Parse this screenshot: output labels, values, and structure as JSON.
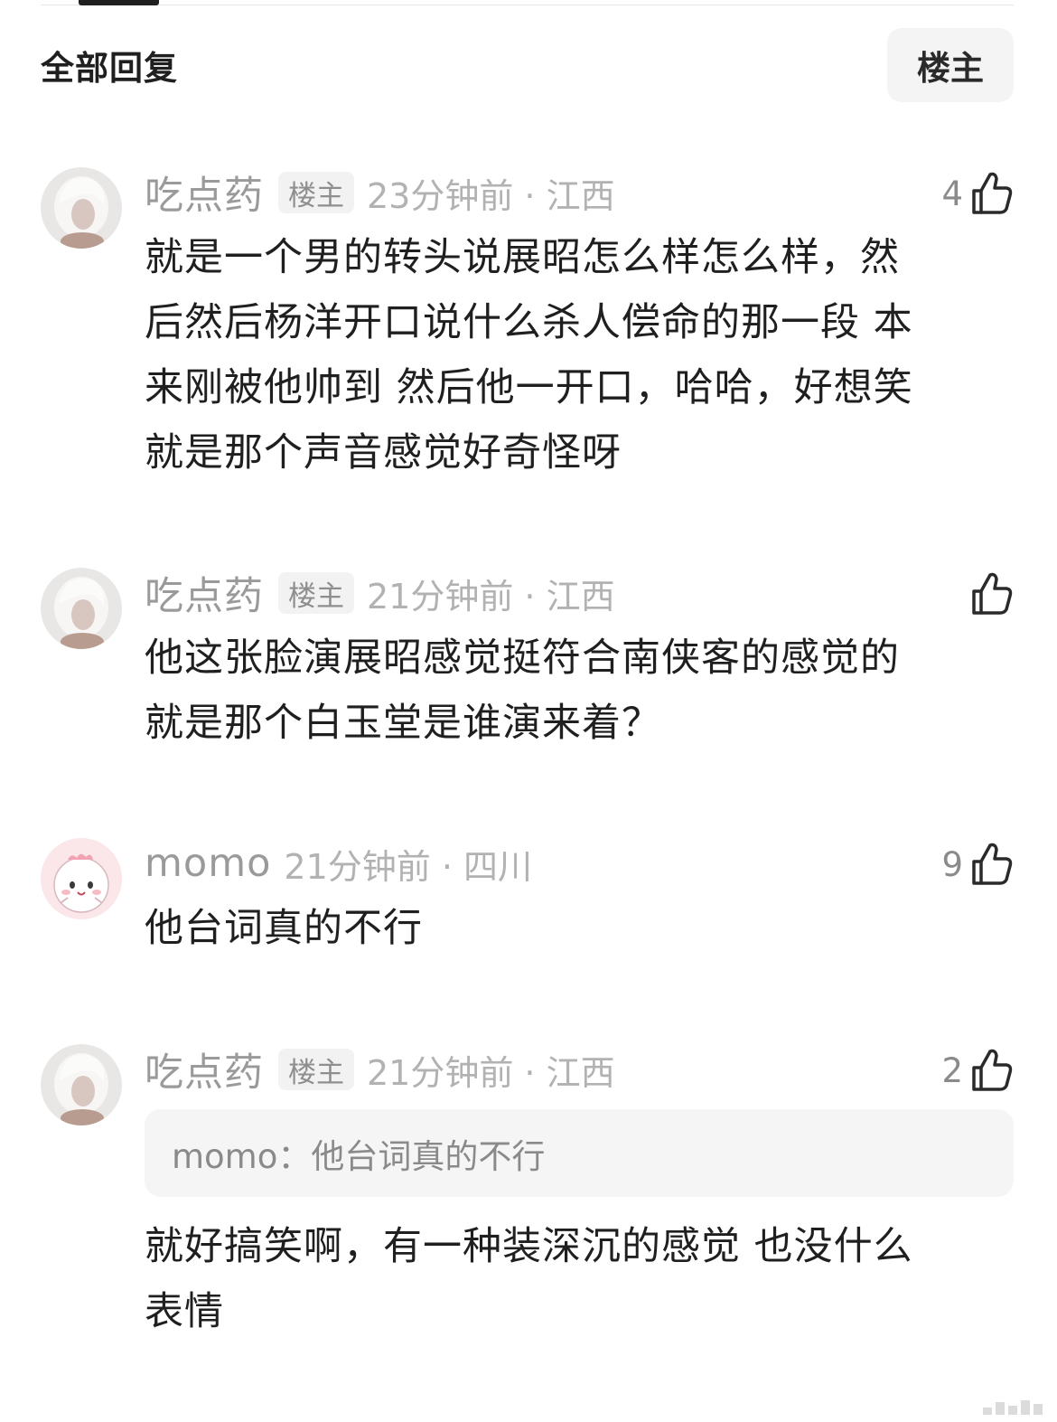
{
  "header": {
    "title": "全部回复",
    "filter_label": "楼主"
  },
  "comments": [
    {
      "username": "吃点药",
      "badge": "楼主",
      "time_location": "23分钟前 · 江西",
      "likes": "4",
      "content": "就是一个男的转头说展昭怎么样怎么样，然后然后杨洋开口说什么杀人偿命的那一段 本来刚被他帅到 然后他一开口，哈哈，好想笑就是那个声音感觉好奇怪呀",
      "lines": [
        "就是一个男的转头说展昭怎么样怎么样，然",
        "后然后杨洋开口说什么杀人偿命的那一段 本",
        "来刚被他帅到 然后他一开口，哈哈，好想笑",
        "就是那个声音感觉好奇怪呀"
      ]
    },
    {
      "username": "吃点药",
      "badge": "楼主",
      "time_location": "21分钟前 · 江西",
      "likes": "",
      "lines": [
        "他这张脸演展昭感觉挺符合南侠客的感觉的",
        "就是那个白玉堂是谁演来着？"
      ]
    },
    {
      "username": "momo",
      "time_location": "21分钟前 · 四川",
      "likes": "9",
      "lines": [
        "他台词真的不行"
      ]
    },
    {
      "username": "吃点药",
      "badge": "楼主",
      "time_location": "21分钟前 · 江西",
      "likes": "2",
      "quote": {
        "user": "momo：",
        "text": "他台词真的不行"
      },
      "lines": [
        "就好搞笑啊，有一种装深沉的感觉 也没什么",
        "表情"
      ]
    }
  ],
  "icons": {
    "like": "thumbs-up-icon"
  },
  "colors": {
    "text_primary": "#1f1f1f",
    "text_meta": "#9a9a9a",
    "badge_bg": "#f2f2f2",
    "quote_bg": "#f5f5f5"
  }
}
